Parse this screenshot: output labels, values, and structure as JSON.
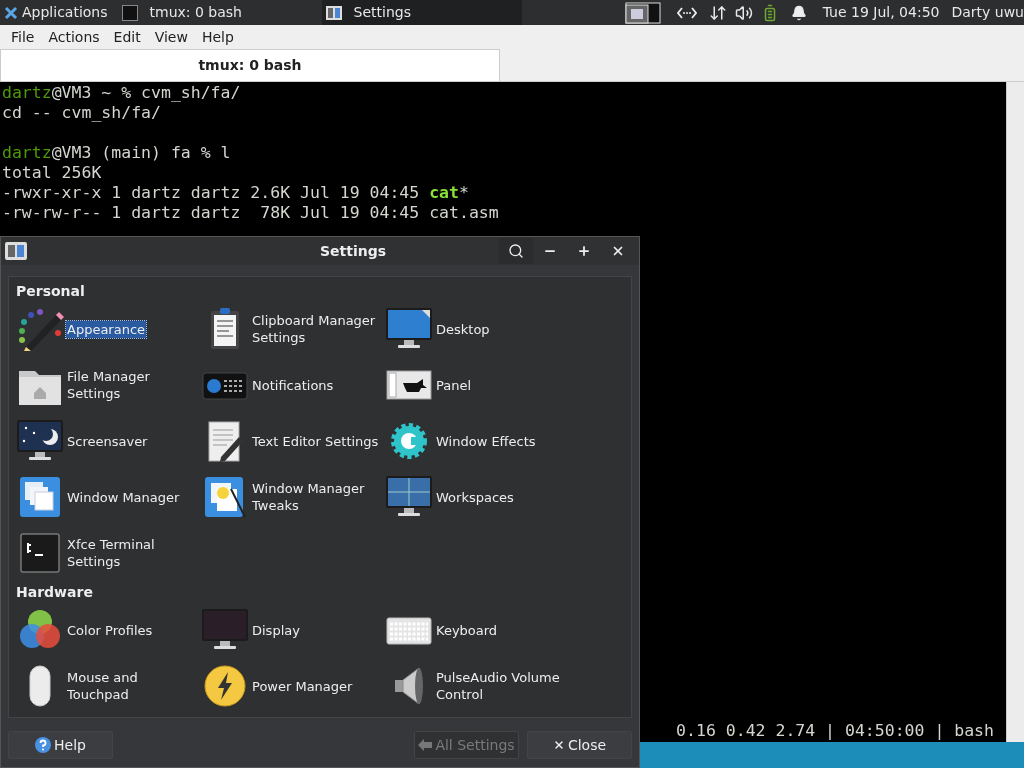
{
  "top_panel": {
    "applications_label": "Applications",
    "tasks": [
      {
        "label": "tmux: 0 bash",
        "selected": false
      },
      {
        "label": "Settings",
        "selected": true
      }
    ],
    "clock": "Tue 19 Jul, 04:50",
    "user": "Darty uwu"
  },
  "terminal": {
    "menu": [
      "File",
      "Actions",
      "Edit",
      "View",
      "Help"
    ],
    "tab": "tmux: 0 bash",
    "blocks": [
      [
        [
          {
            "kind": "user",
            "text": "dartz"
          },
          {
            "kind": "plain",
            "text": "@VM3 ~ % cvm_sh/fa/"
          }
        ],
        [
          {
            "kind": "plain",
            "text": "cd -- cvm_sh/fa/"
          }
        ]
      ],
      [
        [
          {
            "kind": "user",
            "text": "dartz"
          },
          {
            "kind": "plain",
            "text": "@VM3 (main) fa % l"
          }
        ],
        [
          {
            "kind": "plain",
            "text": "total 256K"
          }
        ],
        [
          {
            "kind": "plain",
            "text": "-rwxr-xr-x 1 dartz dartz 2.6K Jul 19 04:45 "
          },
          {
            "kind": "exec",
            "text": "cat"
          },
          {
            "kind": "plain",
            "text": "*"
          }
        ],
        [
          {
            "kind": "plain",
            "text": "-rw-rw-r-- 1 dartz dartz  78K Jul 19 04:45 cat.asm"
          }
        ]
      ]
    ],
    "status_line": "0.16 0.42 2.74 | 04:50:00 | bash"
  },
  "settings": {
    "title": "Settings",
    "sections": [
      {
        "title": "Personal",
        "items": [
          {
            "label": "Appearance",
            "selected": true
          },
          {
            "label": "Clipboard Manager Settings",
            "selected": false
          },
          {
            "label": "Desktop",
            "selected": false
          },
          {
            "label": "File Manager Settings",
            "selected": false
          },
          {
            "label": "Notifications",
            "selected": false
          },
          {
            "label": "Panel",
            "selected": false
          },
          {
            "label": "Screensaver",
            "selected": false
          },
          {
            "label": "Text Editor Settings",
            "selected": false
          },
          {
            "label": "Window Effects",
            "selected": false
          },
          {
            "label": "Window Manager",
            "selected": false
          },
          {
            "label": "Window Manager Tweaks",
            "selected": false
          },
          {
            "label": "Workspaces",
            "selected": false
          },
          {
            "label": "Xfce Terminal Settings",
            "selected": false
          }
        ]
      },
      {
        "title": "Hardware",
        "items": [
          {
            "label": "Color Profiles",
            "selected": false
          },
          {
            "label": "Display",
            "selected": false
          },
          {
            "label": "Keyboard",
            "selected": false
          },
          {
            "label": "Mouse and Touchpad",
            "selected": false
          },
          {
            "label": "Power Manager",
            "selected": false
          },
          {
            "label": "PulseAudio Volume Control",
            "selected": false
          }
        ]
      }
    ],
    "buttons": [
      {
        "label": "Help",
        "kind": "help",
        "disabled": false
      },
      {
        "label": "All Settings",
        "kind": "back",
        "disabled": true
      },
      {
        "label": "Close",
        "kind": "close",
        "disabled": false
      }
    ]
  }
}
